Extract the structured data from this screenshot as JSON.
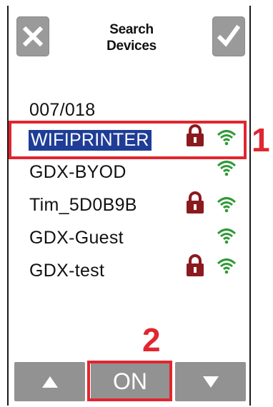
{
  "header": {
    "title_line1": "Search",
    "title_line2": "Devices",
    "close_icon": "close-icon",
    "confirm_icon": "check-icon"
  },
  "networks": [
    {
      "name": "007/018",
      "locked": false,
      "signal": false,
      "selected": false
    },
    {
      "name": "WIFIPRINTER",
      "locked": true,
      "signal": true,
      "selected": true
    },
    {
      "name": "GDX-BYOD",
      "locked": false,
      "signal": true,
      "selected": false
    },
    {
      "name": "Tim_5D0B9B",
      "locked": true,
      "signal": true,
      "selected": false
    },
    {
      "name": "GDX-Guest",
      "locked": false,
      "signal": true,
      "selected": false
    },
    {
      "name": "GDX-test",
      "locked": true,
      "signal": true,
      "selected": false
    }
  ],
  "annotations": {
    "marker_1": "1",
    "marker_2": "2"
  },
  "footer": {
    "up_icon": "triangle-up-icon",
    "toggle_label": "ON",
    "down_icon": "triangle-down-icon"
  },
  "colors": {
    "button_gray": "#929292",
    "selection_blue": "#1f3d96",
    "lock_red": "#8b1a1e",
    "signal_green": "#2e9a36",
    "annotation_red": "#e02630"
  }
}
